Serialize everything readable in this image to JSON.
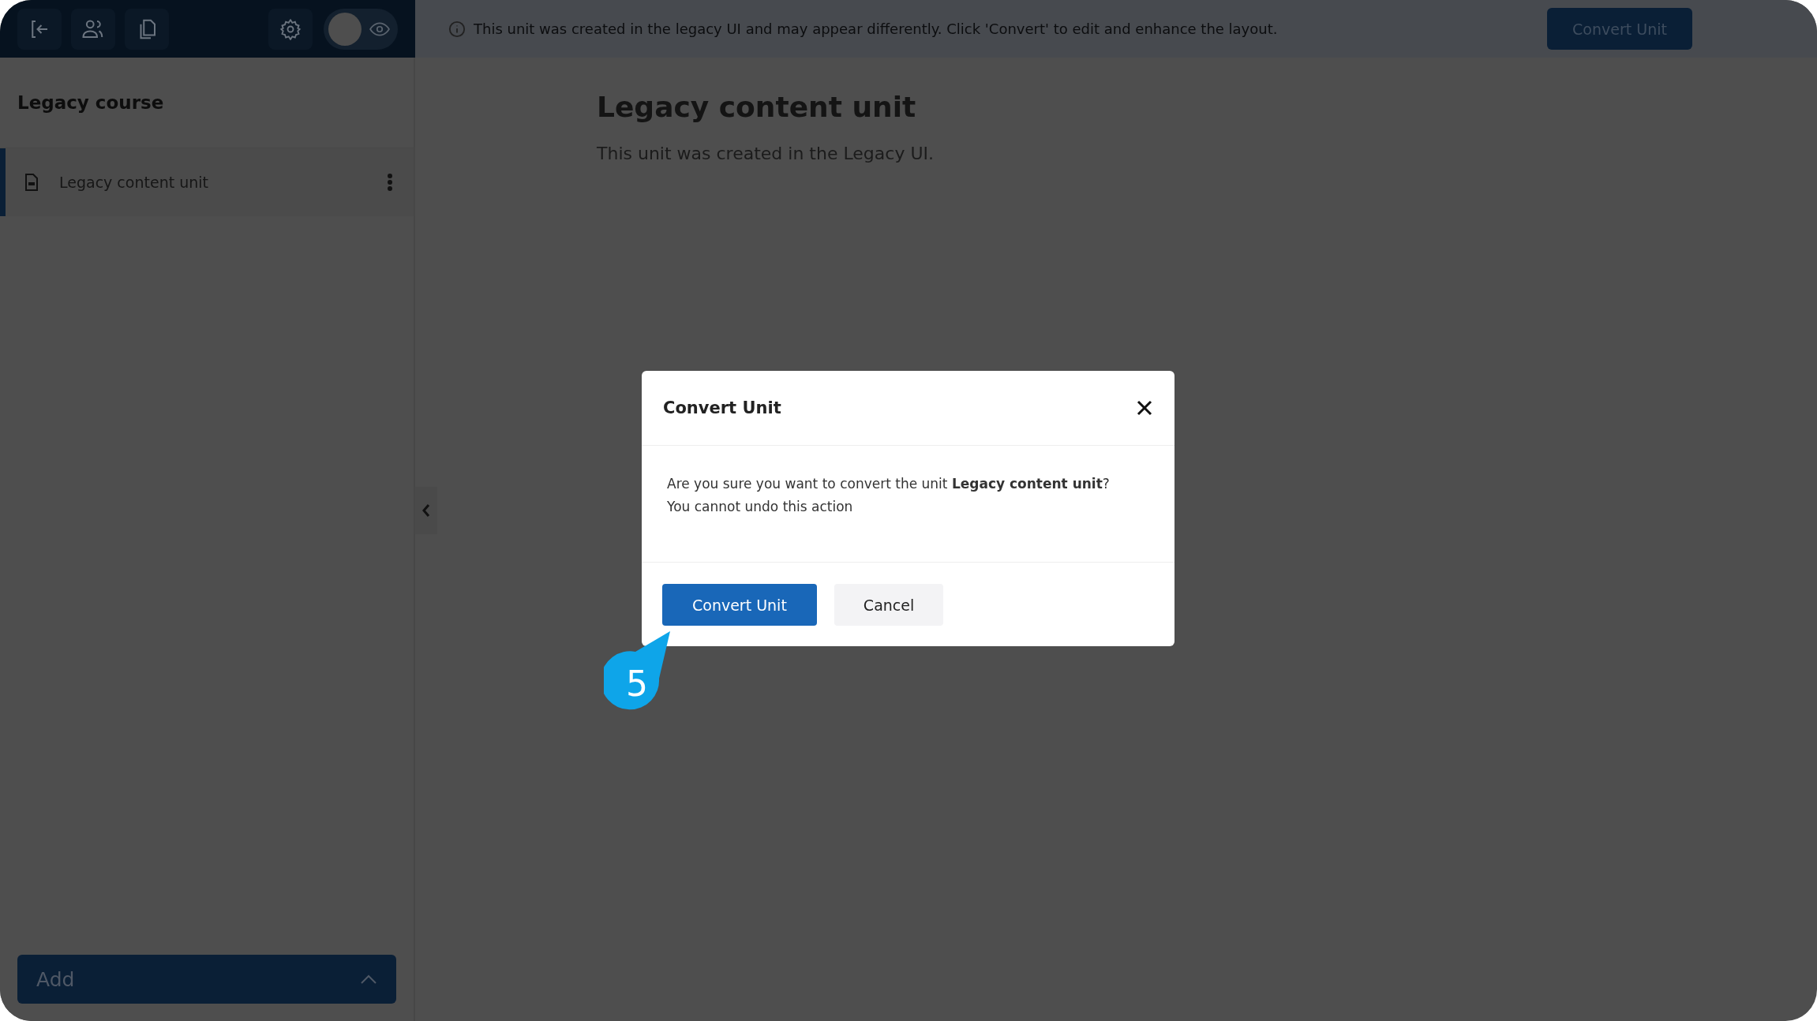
{
  "toolbar": {
    "banner": "This unit was created in the legacy UI and may appear differently. Click 'Convert' to edit and enhance the layout.",
    "convert_button": "Convert Unit"
  },
  "preview_toggle": {
    "on": false
  },
  "sidebar": {
    "title": "Legacy course",
    "items": [
      {
        "label": "Legacy content unit",
        "selected": true
      }
    ],
    "add_button": "Add"
  },
  "content": {
    "title": "Legacy content unit",
    "text": "This unit was created in the Legacy UI."
  },
  "dialog": {
    "title": "Convert Unit",
    "message": "Are you sure you want to convert the unit **Legacy content unit**?",
    "warning": "You cannot undo this action",
    "buttons": [
      {
        "label": "Convert Unit",
        "kind": "primary"
      },
      {
        "label": "Cancel",
        "kind": "secondary"
      }
    ]
  },
  "step_marker": "5"
}
